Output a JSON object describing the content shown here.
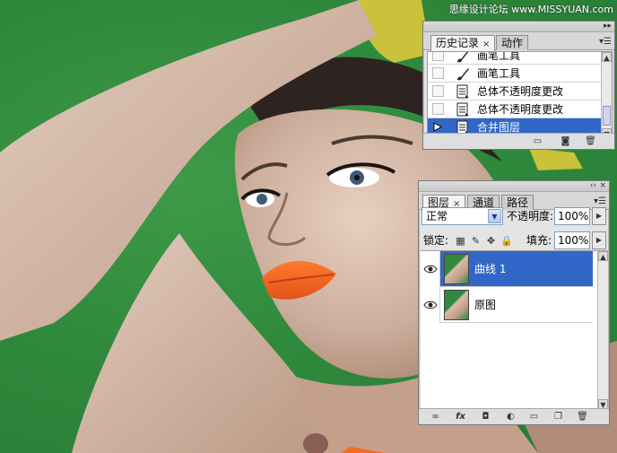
{
  "watermark": "思缘设计论坛 www.MISSYUAN.com",
  "history_panel": {
    "tabs": [
      {
        "label": "历史记录",
        "active": true
      },
      {
        "label": "动作",
        "active": false
      }
    ],
    "items": [
      {
        "label": "画笔工具",
        "icon": "brush-icon",
        "selected": false
      },
      {
        "label": "画笔工具",
        "icon": "brush-icon",
        "selected": false
      },
      {
        "label": "总体不透明度更改",
        "icon": "history-state-icon",
        "selected": false
      },
      {
        "label": "总体不透明度更改",
        "icon": "history-state-icon",
        "selected": false
      },
      {
        "label": "合并图层",
        "icon": "history-state-icon",
        "selected": true
      }
    ]
  },
  "layers_panel": {
    "tabs": [
      {
        "label": "图层",
        "active": true
      },
      {
        "label": "通道",
        "active": false
      },
      {
        "label": "路径",
        "active": false
      }
    ],
    "blend_mode": "正常",
    "opacity_label": "不透明度:",
    "opacity_value": "100%",
    "lock_label": "锁定:",
    "fill_label": "填充:",
    "fill_value": "100%",
    "layers": [
      {
        "name": "曲线 1",
        "selected": true,
        "visible": true
      },
      {
        "name": "原图",
        "selected": false,
        "visible": true
      }
    ],
    "footer_icons": [
      "link-icon",
      "fx-icon",
      "mask-icon",
      "adjustment-icon",
      "folder-icon",
      "new-layer-icon",
      "trash-icon"
    ]
  },
  "colors": {
    "background_green": "#2f8a3d",
    "selection_blue": "#3168c8",
    "lip_orange": "#f56a20"
  }
}
